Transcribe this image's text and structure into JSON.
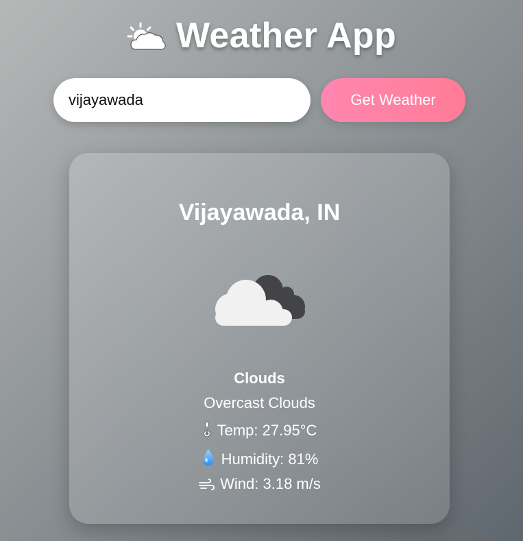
{
  "app": {
    "title": "Weather App",
    "title_icon": "sun-behind-cloud-icon"
  },
  "search": {
    "value": "vijayawada",
    "button_label": "Get Weather"
  },
  "weather": {
    "city": "Vijayawada, IN",
    "icon": "overcast-clouds-icon",
    "main": "Clouds",
    "description": "Overcast Clouds",
    "temp_text": "Temp: 27.95°C",
    "humidity_text": "Humidity: 81%",
    "wind_text": "Wind: 3.18 m/s",
    "temp_icon": "thermometer-icon",
    "humidity_icon": "droplet-icon",
    "wind_icon": "wind-icon"
  },
  "colors": {
    "button_accent": "#ff7c96",
    "card_bg": "rgba(255,255,255,0.15)"
  }
}
